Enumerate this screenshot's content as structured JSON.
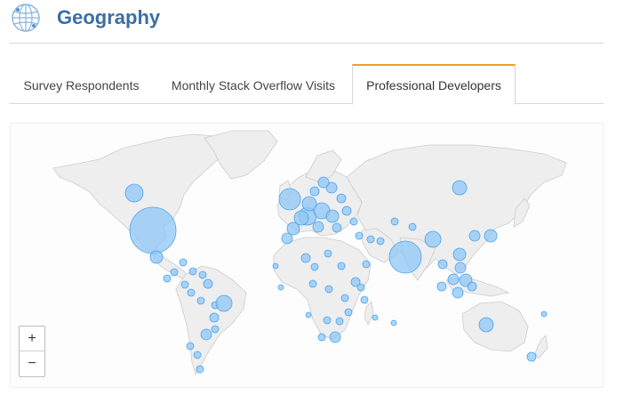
{
  "header": {
    "title": "Geography",
    "icon": "globe-icon"
  },
  "tabs": [
    {
      "label": "Survey Respondents",
      "active": false
    },
    {
      "label": "Monthly Stack Overflow Visits",
      "active": false
    },
    {
      "label": "Professional Developers",
      "active": true
    }
  ],
  "colors": {
    "accent": "#3b6ea5",
    "active_tab_border": "#f29d2b",
    "land": "#eeeeee",
    "border": "#cccccc",
    "bubble_fill": "#8fc7f6",
    "bubble_stroke": "#4aa3ee"
  },
  "zoom": {
    "in_label": "+",
    "out_label": "−"
  },
  "map": {
    "type": "bubble-world-map"
  }
}
